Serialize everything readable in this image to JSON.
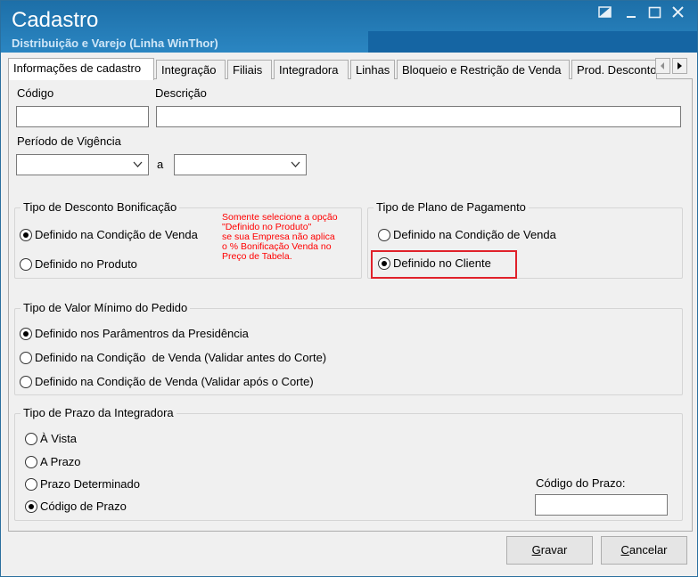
{
  "window": {
    "title": "Cadastro",
    "subtitle": "Distribuição e Varejo (Linha WinThor)"
  },
  "tabs": [
    {
      "label": "Informações de cadastro",
      "active": true
    },
    {
      "label": "Integração"
    },
    {
      "label": "Filiais"
    },
    {
      "label": "Integradora"
    },
    {
      "label": "Linhas"
    },
    {
      "label": "Bloqueio e Restrição de Venda"
    },
    {
      "label": "Prod. Desconto"
    }
  ],
  "form": {
    "codigo_label": "Código",
    "codigo_value": "",
    "descricao_label": "Descrição",
    "descricao_value": "",
    "periodo_label": "Período de Vigência",
    "periodo_sep": "a",
    "periodo_inicio": "",
    "periodo_fim": ""
  },
  "desconto_bonificacao": {
    "legend": "Tipo de Desconto Bonificação",
    "options": [
      {
        "label": "Definido na Condição de Venda",
        "selected": true
      },
      {
        "label": "Definido no Produto",
        "selected": false
      }
    ],
    "note": "Somente selecione a opção\n\"Definido no Produto\"\nse sua Empresa não aplica\no % Bonificação Venda no\nPreço de Tabela."
  },
  "plano_pagamento": {
    "legend": "Tipo de Plano de Pagamento",
    "options": [
      {
        "label": "Definido na Condição de Venda",
        "selected": false
      },
      {
        "label": "Definido no Cliente",
        "selected": true
      }
    ],
    "highlight_color": "#e0212a"
  },
  "valor_minimo": {
    "legend": "Tipo de Valor Mínimo do Pedido",
    "options": [
      {
        "label": "Definido nos Parâmentros da Presidência",
        "selected": true
      },
      {
        "label": "Definido na Condição  de Venda (Validar antes do Corte)",
        "selected": false
      },
      {
        "label": "Definido na Condição de Venda (Validar após o Corte)",
        "selected": false
      }
    ]
  },
  "prazo_integradora": {
    "legend": "Tipo de Prazo da Integradora",
    "options": [
      {
        "label": "À Vista",
        "selected": false
      },
      {
        "label": "A Prazo",
        "selected": false
      },
      {
        "label": "Prazo Determinado",
        "selected": false
      },
      {
        "label": "Código de Prazo",
        "selected": true
      }
    ],
    "codigo_prazo_label": "Código do Prazo:",
    "codigo_prazo_value": ""
  },
  "buttons": {
    "gravar_first": "G",
    "gravar_rest": "ravar",
    "cancelar_first": "C",
    "cancelar_rest": "ancelar"
  },
  "icons": [
    "minimize-to-tray-icon",
    "minimize-icon",
    "maximize-icon",
    "close-icon",
    "chevron-left-icon",
    "chevron-right-icon",
    "chevron-down-icon"
  ]
}
